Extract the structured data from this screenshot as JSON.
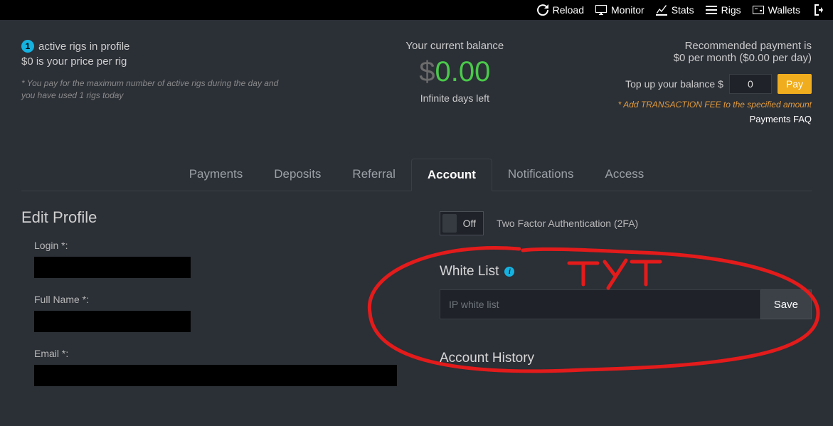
{
  "topnav": {
    "reload": "Reload",
    "monitor": "Monitor",
    "stats": "Stats",
    "rigs": "Rigs",
    "wallets": "Wallets"
  },
  "summary": {
    "active_count": "1",
    "active_label": "active rigs in profile",
    "price_line": "$0 is your price per rig",
    "fineprint": "* You pay for the maximum number of active rigs during the day and you have used 1 rigs today",
    "balance_label": "Your current balance",
    "balance_currency": "$",
    "balance_amount": "0.00",
    "days_left": "Infinite days left",
    "recommended": "Recommended payment is",
    "recommended_value": "$0 per month ($0.00 per day)",
    "topup_label": "Top up your balance $",
    "topup_value": "0",
    "pay_button": "Pay",
    "fee_note": "* Add TRANSACTION FEE to the specified amount",
    "faq": "Payments FAQ"
  },
  "tabs": {
    "payments": "Payments",
    "deposits": "Deposits",
    "referral": "Referral",
    "account": "Account",
    "notifications": "Notifications",
    "access": "Access"
  },
  "account": {
    "edit_profile": "Edit Profile",
    "login_label": "Login *:",
    "fullname_label": "Full Name *:",
    "email_label": "Email *:",
    "toggle_off": "Off",
    "tfa_label": "Two Factor Authentication (2FA)",
    "whitelist_heading": "White List",
    "whitelist_placeholder": "IP white list",
    "save": "Save",
    "history_heading": "Account History"
  },
  "annotation_text": "ТУТ"
}
